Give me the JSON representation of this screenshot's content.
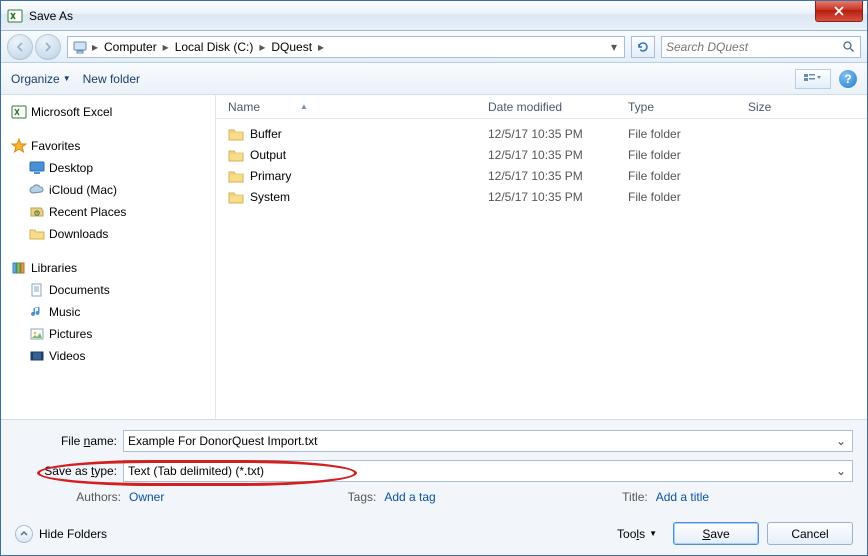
{
  "window": {
    "title": "Save As"
  },
  "nav": {
    "crumbs": [
      "Computer",
      "Local Disk (C:)",
      "DQuest"
    ],
    "search_placeholder": "Search DQuest"
  },
  "toolbar": {
    "organize": "Organize",
    "new_folder": "New folder"
  },
  "sidebar": {
    "excel": "Microsoft Excel",
    "favorites": "Favorites",
    "fav_items": [
      "Desktop",
      "iCloud (Mac)",
      "Recent Places",
      "Downloads"
    ],
    "libraries": "Libraries",
    "lib_items": [
      "Documents",
      "Music",
      "Pictures",
      "Videos"
    ]
  },
  "columns": {
    "name": "Name",
    "date": "Date modified",
    "type": "Type",
    "size": "Size"
  },
  "files": [
    {
      "name": "Buffer",
      "date": "12/5/17 10:35 PM",
      "type": "File folder",
      "size": ""
    },
    {
      "name": "Output",
      "date": "12/5/17 10:35 PM",
      "type": "File folder",
      "size": ""
    },
    {
      "name": "Primary",
      "date": "12/5/17 10:35 PM",
      "type": "File folder",
      "size": ""
    },
    {
      "name": "System",
      "date": "12/5/17 10:35 PM",
      "type": "File folder",
      "size": ""
    }
  ],
  "form": {
    "filename_label": "File name:",
    "filename_value": "Example For DonorQuest Import.txt",
    "type_label": "Save as type:",
    "type_value": "Text (Tab delimited) (*.txt)"
  },
  "meta": {
    "authors_label": "Authors:",
    "authors_value": "Owner",
    "tags_label": "Tags:",
    "tags_value": "Add a tag",
    "title_label": "Title:",
    "title_value": "Add a title"
  },
  "footer": {
    "hide": "Hide Folders",
    "tools": "Tools",
    "save": "Save",
    "cancel": "Cancel"
  }
}
